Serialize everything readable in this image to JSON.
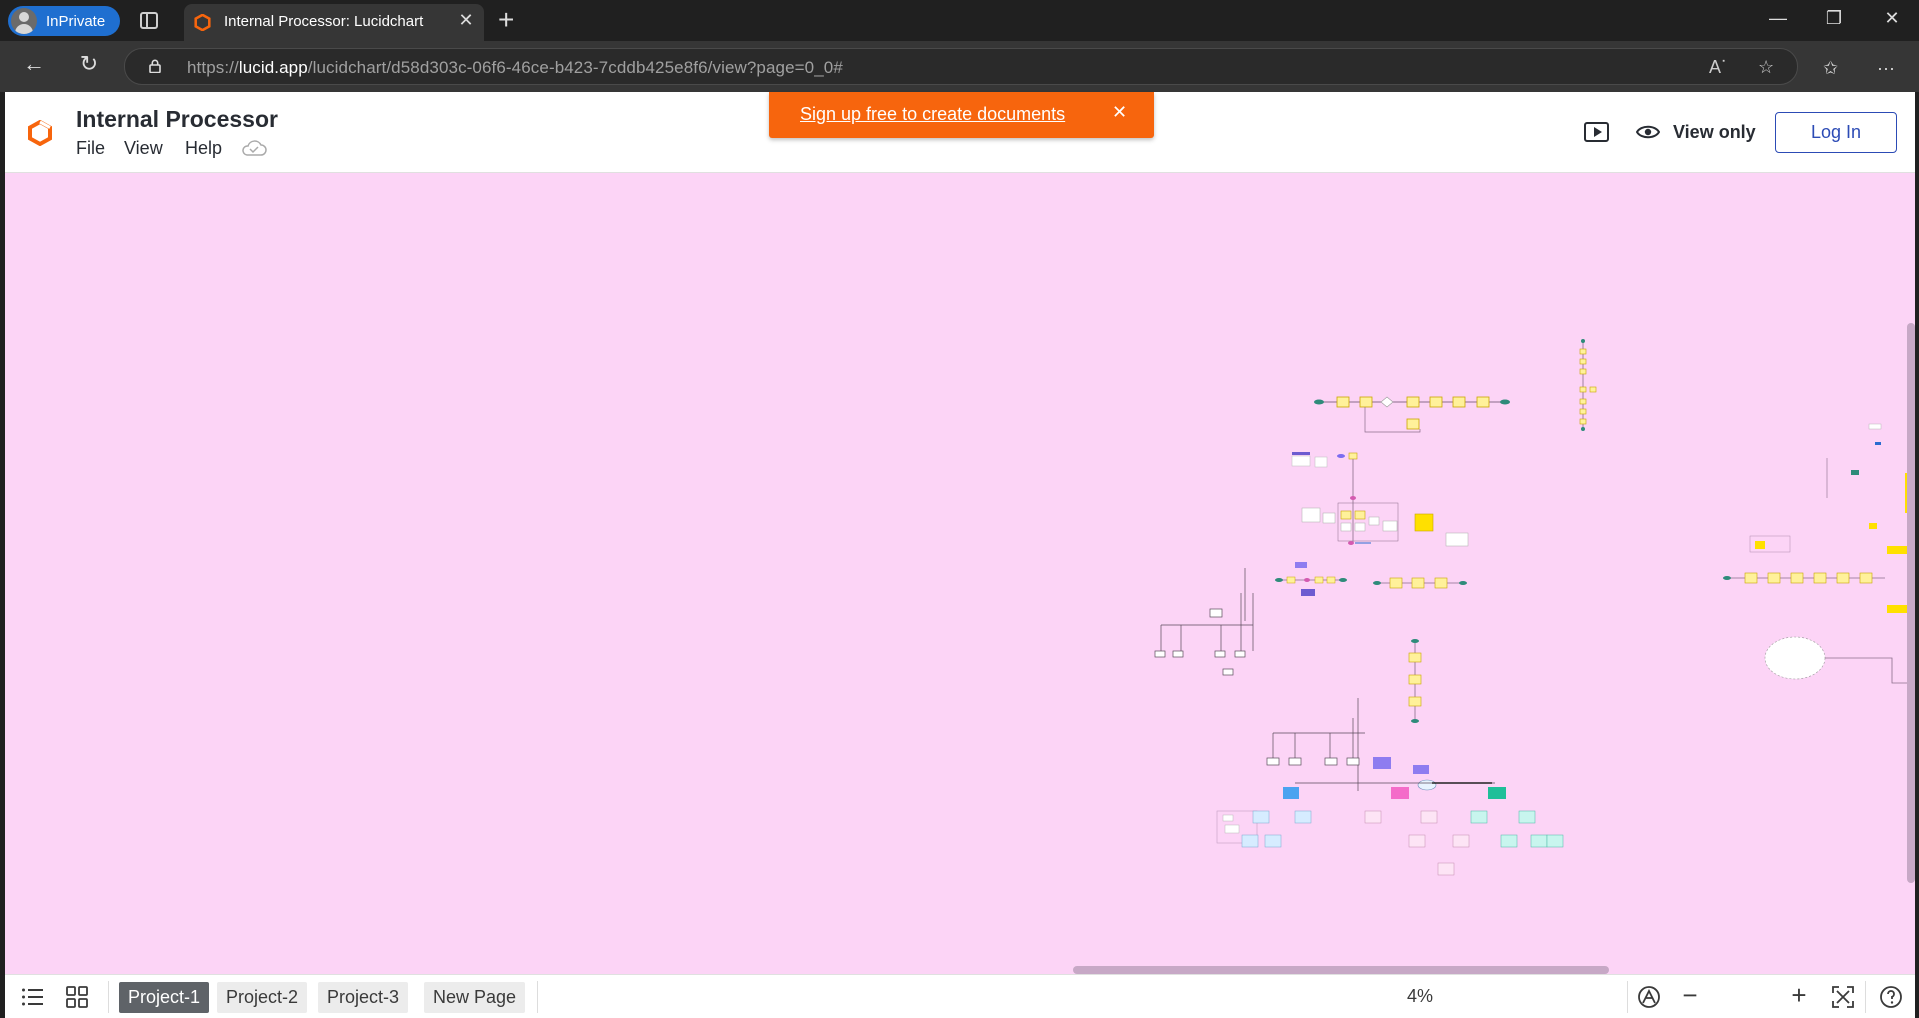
{
  "browser": {
    "inprivate_label": "InPrivate",
    "tab_title": "Internal Processor: Lucidchart",
    "url_host": "lucid.app",
    "url_prefix": "https://",
    "url_path": "/lucidchart/d58d303c-06f6-46ce-b423-7cddb425e8f6/view?page=0_0#"
  },
  "header": {
    "doc_title": "Internal Processor",
    "menu": [
      "File",
      "View",
      "Help"
    ],
    "banner_text": "Sign up free to create documents",
    "view_only_label": "View only",
    "login_label": "Log In"
  },
  "footer": {
    "pages": [
      "Project-1",
      "Project-2",
      "Project-3",
      "New Page"
    ],
    "active_page": "Project-1",
    "zoom": "4%"
  },
  "colors": {
    "canvas_bg": "#fcd4f6",
    "brand_orange": "#f7650d",
    "login_blue": "#2c4bb5"
  }
}
